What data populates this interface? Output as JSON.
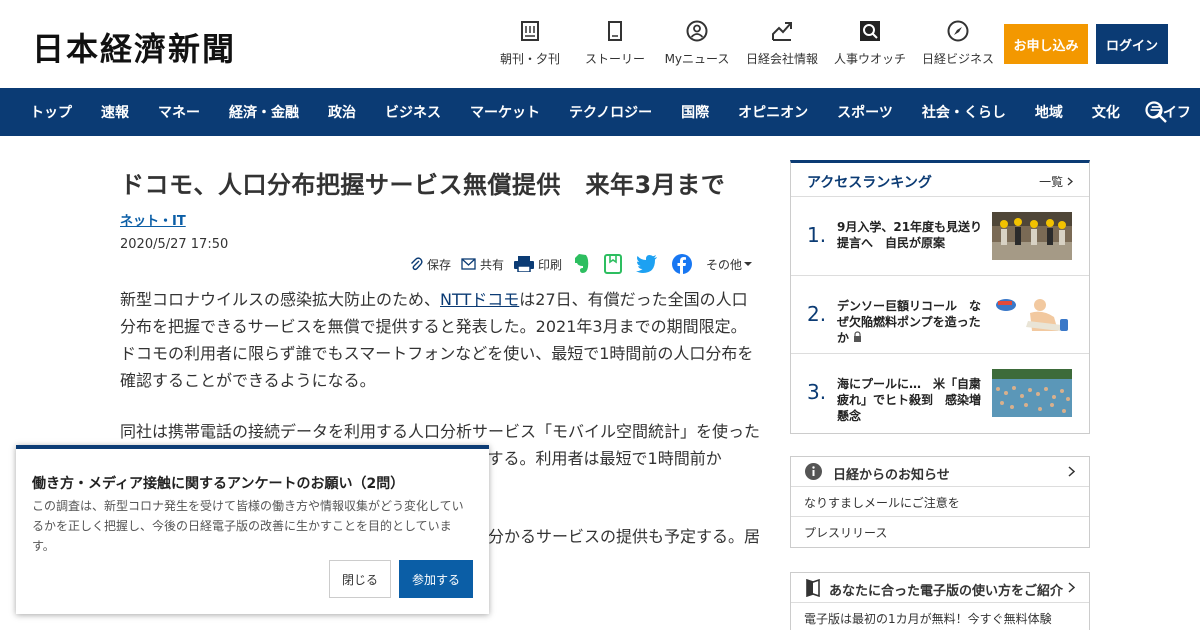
{
  "header": {
    "logo": "日本経濟新聞",
    "tools": [
      {
        "label": "朝刊・夕刊",
        "icon": "newspaper-icon"
      },
      {
        "label": "ストーリー",
        "icon": "document-icon"
      },
      {
        "label": "Myニュース",
        "icon": "person-icon"
      },
      {
        "label": "日経会社情報",
        "icon": "chart-icon"
      },
      {
        "label": "人事ウオッチ",
        "icon": "search-person-icon"
      },
      {
        "label": "日経ビジネス",
        "icon": "compass-icon"
      }
    ],
    "apply_label": "お申し込み",
    "login_label": "ログイン",
    "accent_orange": "#f39800",
    "brand_navy": "#0b3b74"
  },
  "nav": {
    "items": [
      "トップ",
      "速報",
      "マネー",
      "経済・金融",
      "政治",
      "ビジネス",
      "マーケット",
      "テクノロジー",
      "国際",
      "オピニオン",
      "スポーツ",
      "社会・くらし",
      "地域",
      "文化",
      "ライフ"
    ]
  },
  "article": {
    "title": "ドコモ、人口分布把握サービス無償提供　来年3月まで",
    "category": "ネット・IT",
    "date": "2020/5/27 17:50",
    "share": {
      "save": "保存",
      "share": "共有",
      "print": "印刷",
      "more": "その他"
    },
    "p1_before": "新型コロナウイルスの感染拡大防止のため、",
    "p1_link": "NTTドコモ",
    "p1_after": "は27日、有償だった全国の人口分布を把握できるサービスを無償で提供すると発表した。2021年3月までの期間限定。ドコモの利用者に限らず誰でもスマートフォンなどを使い、最短で1時間前の人口分布を確認することができるようになる。",
    "p2": "同社は携帯電話の接続データを利用する人口分析サービス「モバイル空間統計」を使った人口分布の状況を、地図上に可視化して無償で提供する。利用者は最短で1時間前か　　　　　　　　　　　　　　　　　　　　　　　るという。",
    "p3": "　　　　　　　　　　　　　　　　　　　　　　　分かるサービスの提供も予定する。居　　　　　　　　　　　　　　　　　　　　　　　の感染拡大防止に役立ててほしいと"
  },
  "ranking": {
    "title": "アクセスランキング",
    "all_label": "一覧",
    "items": [
      {
        "num": "1.",
        "text": "9月入学、21年度も見送り提言へ　自民が原案"
      },
      {
        "num": "2.",
        "text": "デンソー巨額リコール　なぜ欠陥燃料ポンプを造ったか"
      },
      {
        "num": "3.",
        "text": "海にプールに…　米「自粛疲れ」でヒト殺到　感染増懸念"
      }
    ]
  },
  "notice": {
    "title": "日経からのお知らせ",
    "items": [
      "なりすましメールにご注意を",
      "プレスリリース"
    ]
  },
  "guide": {
    "title": "あなたに合った電子版の使い方をご紹介",
    "text": "電子版は最初の1カ月が無料！今すぐ無料体験"
  },
  "survey": {
    "title": "働き方・メディア接触に関するアンケートのお願い（2問）",
    "desc": "この調査は、新型コロナ発生を受けて皆様の働き方や情報収集がどう変化しているかを正しく把握し、今後の日経電子版の改善に生かすことを目的としています。",
    "close_label": "閉じる",
    "join_label": "参加する"
  }
}
